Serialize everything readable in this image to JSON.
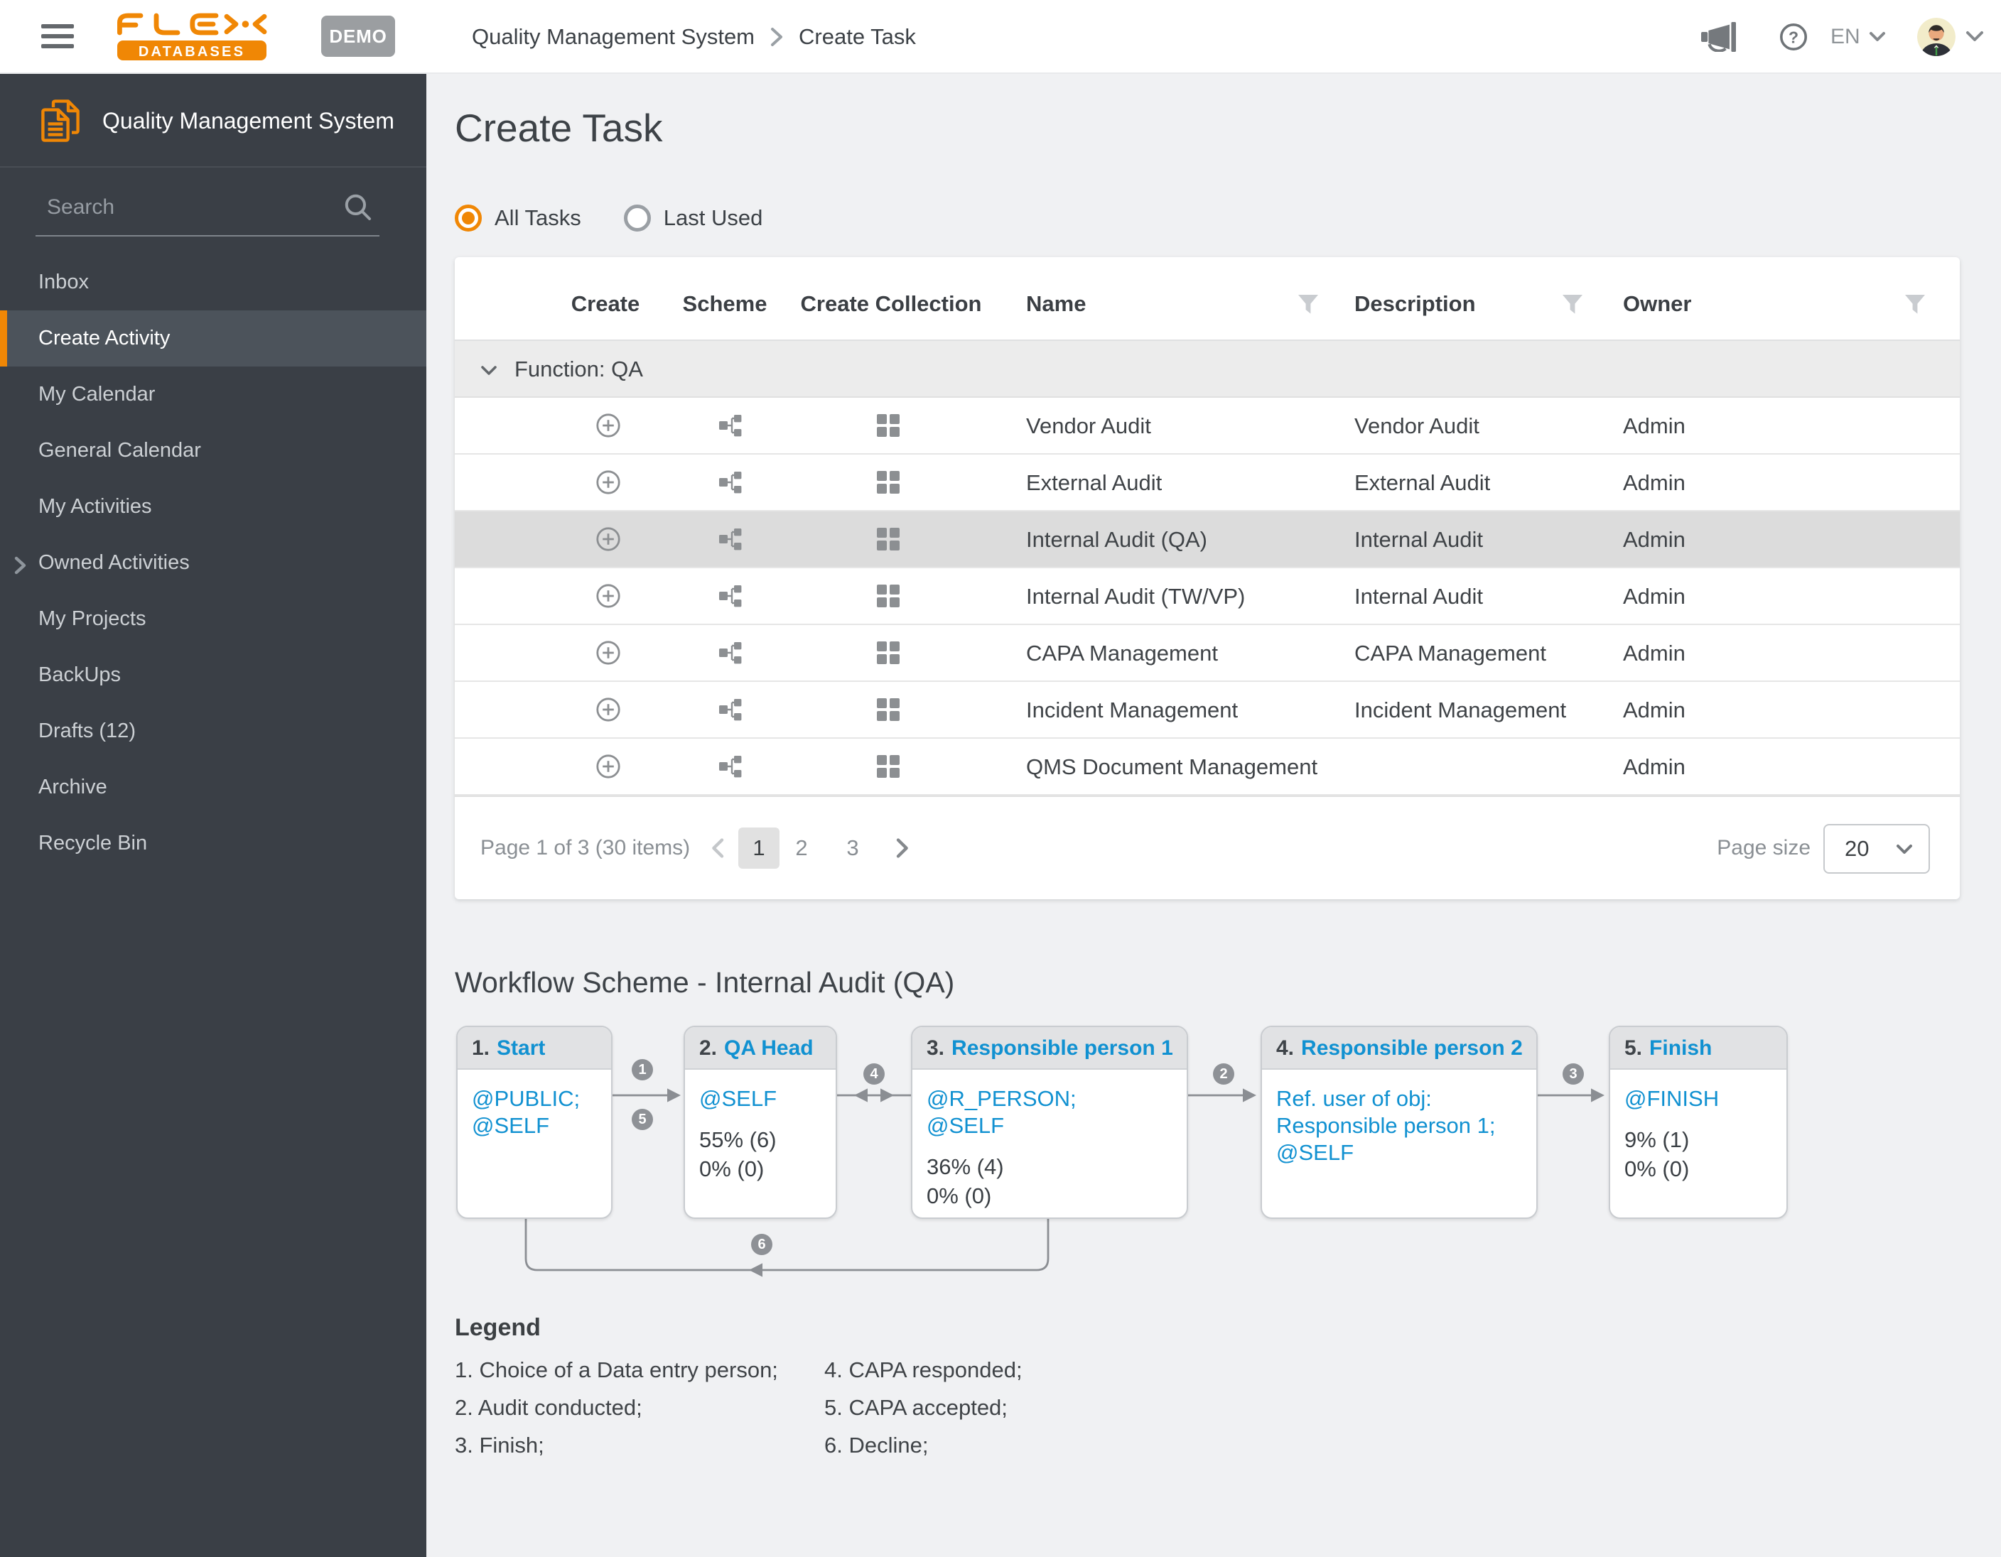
{
  "topbar": {
    "brand": {
      "top": "FLEX",
      "bottom": "DATABASES"
    },
    "env_badge": "DEMO",
    "breadcrumb": {
      "root": "Quality Management System",
      "current": "Create Task"
    },
    "language": "EN"
  },
  "sidebar": {
    "title": "Quality Management System",
    "search_placeholder": "Search",
    "items": [
      {
        "label": "Inbox"
      },
      {
        "label": "Create Activity",
        "active": true
      },
      {
        "label": "My Calendar"
      },
      {
        "label": "General Calendar"
      },
      {
        "label": "My Activities"
      },
      {
        "label": "Owned Activities",
        "expandable": true
      },
      {
        "label": "My Projects"
      },
      {
        "label": "BackUps"
      },
      {
        "label": "Drafts (12)"
      },
      {
        "label": "Archive"
      },
      {
        "label": "Recycle Bin"
      }
    ]
  },
  "main": {
    "title": "Create Task",
    "filters": {
      "all_tasks": "All Tasks",
      "last_used": "Last Used",
      "selected": "All Tasks"
    },
    "table": {
      "columns": {
        "create": "Create",
        "scheme": "Scheme",
        "create_collection": "Create Collection",
        "name": "Name",
        "description": "Description",
        "owner": "Owner"
      },
      "group_label": "Function: QA",
      "rows": [
        {
          "name": "Vendor Audit",
          "description": "Vendor Audit",
          "owner": "Admin"
        },
        {
          "name": "External Audit",
          "description": "External Audit",
          "owner": "Admin"
        },
        {
          "name": "Internal Audit (QA)",
          "description": "Internal Audit",
          "owner": "Admin",
          "selected": true
        },
        {
          "name": "Internal Audit (TW/VP)",
          "description": "Internal Audit",
          "owner": "Admin"
        },
        {
          "name": "CAPA Management",
          "description": "CAPA Management",
          "owner": "Admin"
        },
        {
          "name": "Incident Management",
          "description": "Incident Management",
          "owner": "Admin"
        },
        {
          "name": "QMS Document Management",
          "description": "",
          "owner": "Admin"
        }
      ]
    },
    "pagination": {
      "summary": "Page 1 of 3  (30 items)",
      "pages": [
        "1",
        "2",
        "3"
      ],
      "current_page": "1",
      "page_size_label": "Page size",
      "page_size": "20"
    },
    "workflow": {
      "title": "Workflow Scheme - Internal Audit (QA)",
      "nodes": [
        {
          "num": "1.",
          "name": "Start",
          "lines": [
            "@PUBLIC;",
            "@SELF"
          ],
          "stats": []
        },
        {
          "num": "2.",
          "name": "QA Head",
          "lines": [
            "@SELF"
          ],
          "stats": [
            "55% (6)",
            "0% (0)"
          ]
        },
        {
          "num": "3.",
          "name": "Responsible person 1",
          "lines": [
            "@R_PERSON;",
            "@SELF"
          ],
          "stats": [
            "36% (4)",
            "0% (0)"
          ]
        },
        {
          "num": "4.",
          "name": "Responsible person 2",
          "lines": [
            "Ref. user of obj:",
            "Responsible person 1;",
            "@SELF"
          ],
          "stats": []
        },
        {
          "num": "5.",
          "name": "Finish",
          "lines": [
            "@FINISH"
          ],
          "stats": [
            "9% (1)",
            "0% (0)"
          ]
        }
      ],
      "connector_labels": [
        "1",
        "5",
        "4",
        "2",
        "3",
        "6"
      ],
      "legend": {
        "title": "Legend",
        "column1": [
          "1. Choice of a Data entry person;",
          "2. Audit conducted;",
          "3. Finish;"
        ],
        "column2": [
          "4. CAPA responded;",
          "5. CAPA accepted;",
          "6. Decline;"
        ]
      }
    }
  },
  "colors": {
    "accent_orange": "#f08705",
    "link_blue": "#1191d1",
    "sidebar_bg": "#3a3f46",
    "selected_row_bg": "#dcdcdc",
    "demo_badge_bg": "#9b9ea1"
  }
}
